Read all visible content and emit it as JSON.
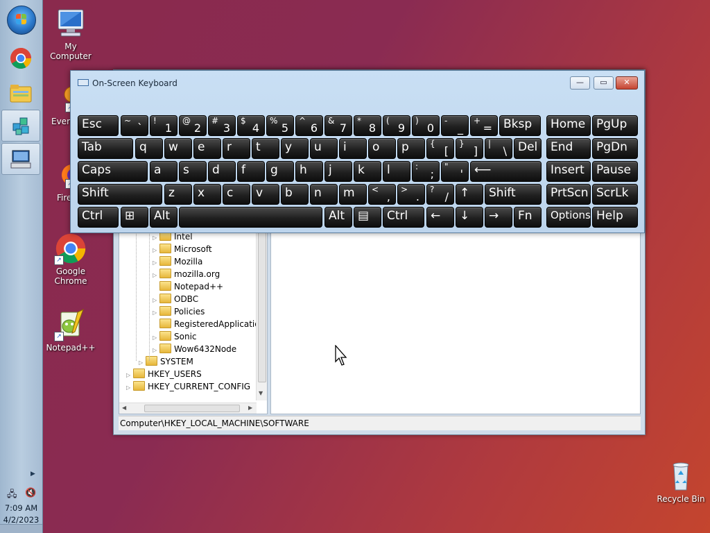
{
  "desktop": {
    "icons": [
      {
        "id": "my-computer",
        "label": "My Computer"
      },
      {
        "id": "everything",
        "label": "Every"
      },
      {
        "id": "firefox",
        "label": "Fire"
      },
      {
        "id": "google-chrome",
        "label": "Google Chrome"
      },
      {
        "id": "notepadpp",
        "label": "Notepad++"
      },
      {
        "id": "recycle-bin",
        "label": "Recycle Bin"
      }
    ]
  },
  "taskbar": {
    "clock_time": "7:09 AM",
    "clock_date": "4/2/2023",
    "pinned": [
      "start-orb",
      "chrome-icon",
      "file-explorer-icon",
      "regedit-icon",
      "osk-icon"
    ]
  },
  "osk": {
    "title": "On-Screen Keyboard",
    "controls": {
      "minimize": "—",
      "maximize": "▭",
      "close": "✕"
    },
    "rows": [
      [
        {
          "label": "Esc"
        },
        {
          "sh": "~",
          "mn": "`"
        },
        {
          "sh": "!",
          "mn": "1"
        },
        {
          "sh": "@",
          "mn": "2"
        },
        {
          "sh": "#",
          "mn": "3"
        },
        {
          "sh": "$",
          "mn": "4"
        },
        {
          "sh": "%",
          "mn": "5"
        },
        {
          "sh": "^",
          "mn": "6"
        },
        {
          "sh": "&",
          "mn": "7"
        },
        {
          "sh": "*",
          "mn": "8"
        },
        {
          "sh": "(",
          "mn": "9"
        },
        {
          "sh": ")",
          "mn": "0"
        },
        {
          "sh": "-",
          "mn": "_"
        },
        {
          "sh": "+",
          "mn": "="
        },
        {
          "label": "Bksp"
        },
        {
          "label": "Home"
        },
        {
          "label": "PgUp"
        }
      ],
      [
        {
          "label": "Tab"
        },
        {
          "label": "q"
        },
        {
          "label": "w"
        },
        {
          "label": "e"
        },
        {
          "label": "r"
        },
        {
          "label": "t"
        },
        {
          "label": "y"
        },
        {
          "label": "u"
        },
        {
          "label": "i"
        },
        {
          "label": "o"
        },
        {
          "label": "p"
        },
        {
          "sh": "{",
          "mn": "["
        },
        {
          "sh": "}",
          "mn": "]"
        },
        {
          "sh": "|",
          "mn": "\\"
        },
        {
          "label": "Del"
        },
        {
          "label": "End"
        },
        {
          "label": "PgDn"
        }
      ],
      [
        {
          "label": "Caps"
        },
        {
          "label": "a"
        },
        {
          "label": "s"
        },
        {
          "label": "d"
        },
        {
          "label": "f"
        },
        {
          "label": "g"
        },
        {
          "label": "h"
        },
        {
          "label": "j"
        },
        {
          "label": "k"
        },
        {
          "label": "l"
        },
        {
          "sh": ":",
          "mn": ";"
        },
        {
          "sh": "\"",
          "mn": "'"
        },
        {
          "label": "⟵"
        },
        {
          "label": "Insert"
        },
        {
          "label": "Pause"
        }
      ],
      [
        {
          "label": "Shift"
        },
        {
          "label": "z"
        },
        {
          "label": "x"
        },
        {
          "label": "c"
        },
        {
          "label": "v"
        },
        {
          "label": "b"
        },
        {
          "label": "n"
        },
        {
          "label": "m"
        },
        {
          "sh": "<",
          "mn": ","
        },
        {
          "sh": ">",
          "mn": "."
        },
        {
          "sh": "?",
          "mn": "/"
        },
        {
          "label": "↑"
        },
        {
          "label": "Shift"
        },
        {
          "label": "PrtScn"
        },
        {
          "label": "ScrLk"
        }
      ],
      [
        {
          "label": "Ctrl"
        },
        {
          "label": "⊞"
        },
        {
          "label": "Alt"
        },
        {
          "label": ""
        },
        {
          "label": "Alt"
        },
        {
          "label": "▤"
        },
        {
          "label": "Ctrl"
        },
        {
          "label": "←"
        },
        {
          "label": "↓"
        },
        {
          "label": "→"
        },
        {
          "label": "Fn"
        },
        {
          "label": "Options"
        },
        {
          "label": "Help"
        }
      ]
    ]
  },
  "regedit": {
    "tree": [
      {
        "label": "Intel",
        "level": 2,
        "expandable": true
      },
      {
        "label": "Microsoft",
        "level": 2,
        "expandable": true
      },
      {
        "label": "Mozilla",
        "level": 2,
        "expandable": true
      },
      {
        "label": "mozilla.org",
        "level": 2,
        "expandable": true
      },
      {
        "label": "Notepad++",
        "level": 2,
        "expandable": false
      },
      {
        "label": "ODBC",
        "level": 2,
        "expandable": true
      },
      {
        "label": "Policies",
        "level": 2,
        "expandable": true
      },
      {
        "label": "RegisteredApplications",
        "level": 2,
        "expandable": false
      },
      {
        "label": "Sonic",
        "level": 2,
        "expandable": true
      },
      {
        "label": "Wow6432Node",
        "level": 2,
        "expandable": true
      },
      {
        "label": "SYSTEM",
        "level": 1,
        "expandable": true
      },
      {
        "label": "HKEY_USERS",
        "level": 0,
        "expandable": true
      },
      {
        "label": "HKEY_CURRENT_CONFIG",
        "level": 0,
        "expandable": true
      }
    ],
    "status_path": "Computer\\HKEY_LOCAL_MACHINE\\SOFTWARE"
  }
}
